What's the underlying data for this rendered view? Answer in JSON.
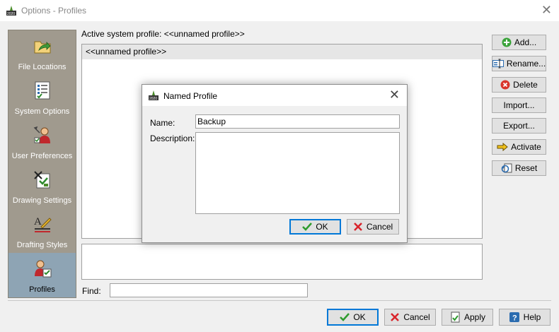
{
  "window": {
    "title": "Options - Profiles",
    "close_glyph": "✕"
  },
  "sidebar": {
    "items": [
      {
        "label": "File Locations",
        "icon": "folder-arrow-icon"
      },
      {
        "label": "System Options",
        "icon": "checklist-icon"
      },
      {
        "label": "User Preferences",
        "icon": "user-prefs-icon"
      },
      {
        "label": "Drawing Settings",
        "icon": "drawing-settings-icon"
      },
      {
        "label": "Drafting Styles",
        "icon": "drafting-styles-icon"
      },
      {
        "label": "Profiles",
        "icon": "profiles-icon",
        "selected": true
      }
    ]
  },
  "main": {
    "active_profile_label": "Active system profile:  <<unnamed profile>>",
    "profiles": [
      "<<unnamed profile>>"
    ],
    "find_label": "Find:",
    "find_value": ""
  },
  "actions": {
    "add": "Add...",
    "rename": "Rename...",
    "delete": "Delete",
    "import": "Import...",
    "export": "Export...",
    "activate": "Activate",
    "reset": "Reset"
  },
  "footer": {
    "ok": "OK",
    "cancel": "Cancel",
    "apply": "Apply",
    "help": "Help"
  },
  "dialog": {
    "title": "Named Profile",
    "close_glyph": "✕",
    "name_label": "Name:",
    "name_value": "Backup",
    "description_label": "Description:",
    "description_value": "",
    "ok": "OK",
    "cancel": "Cancel"
  },
  "colors": {
    "sidebar_bg": "#a09a8e",
    "sidebar_selected": "#8ea4b4",
    "default_button_border": "#0078d7"
  }
}
